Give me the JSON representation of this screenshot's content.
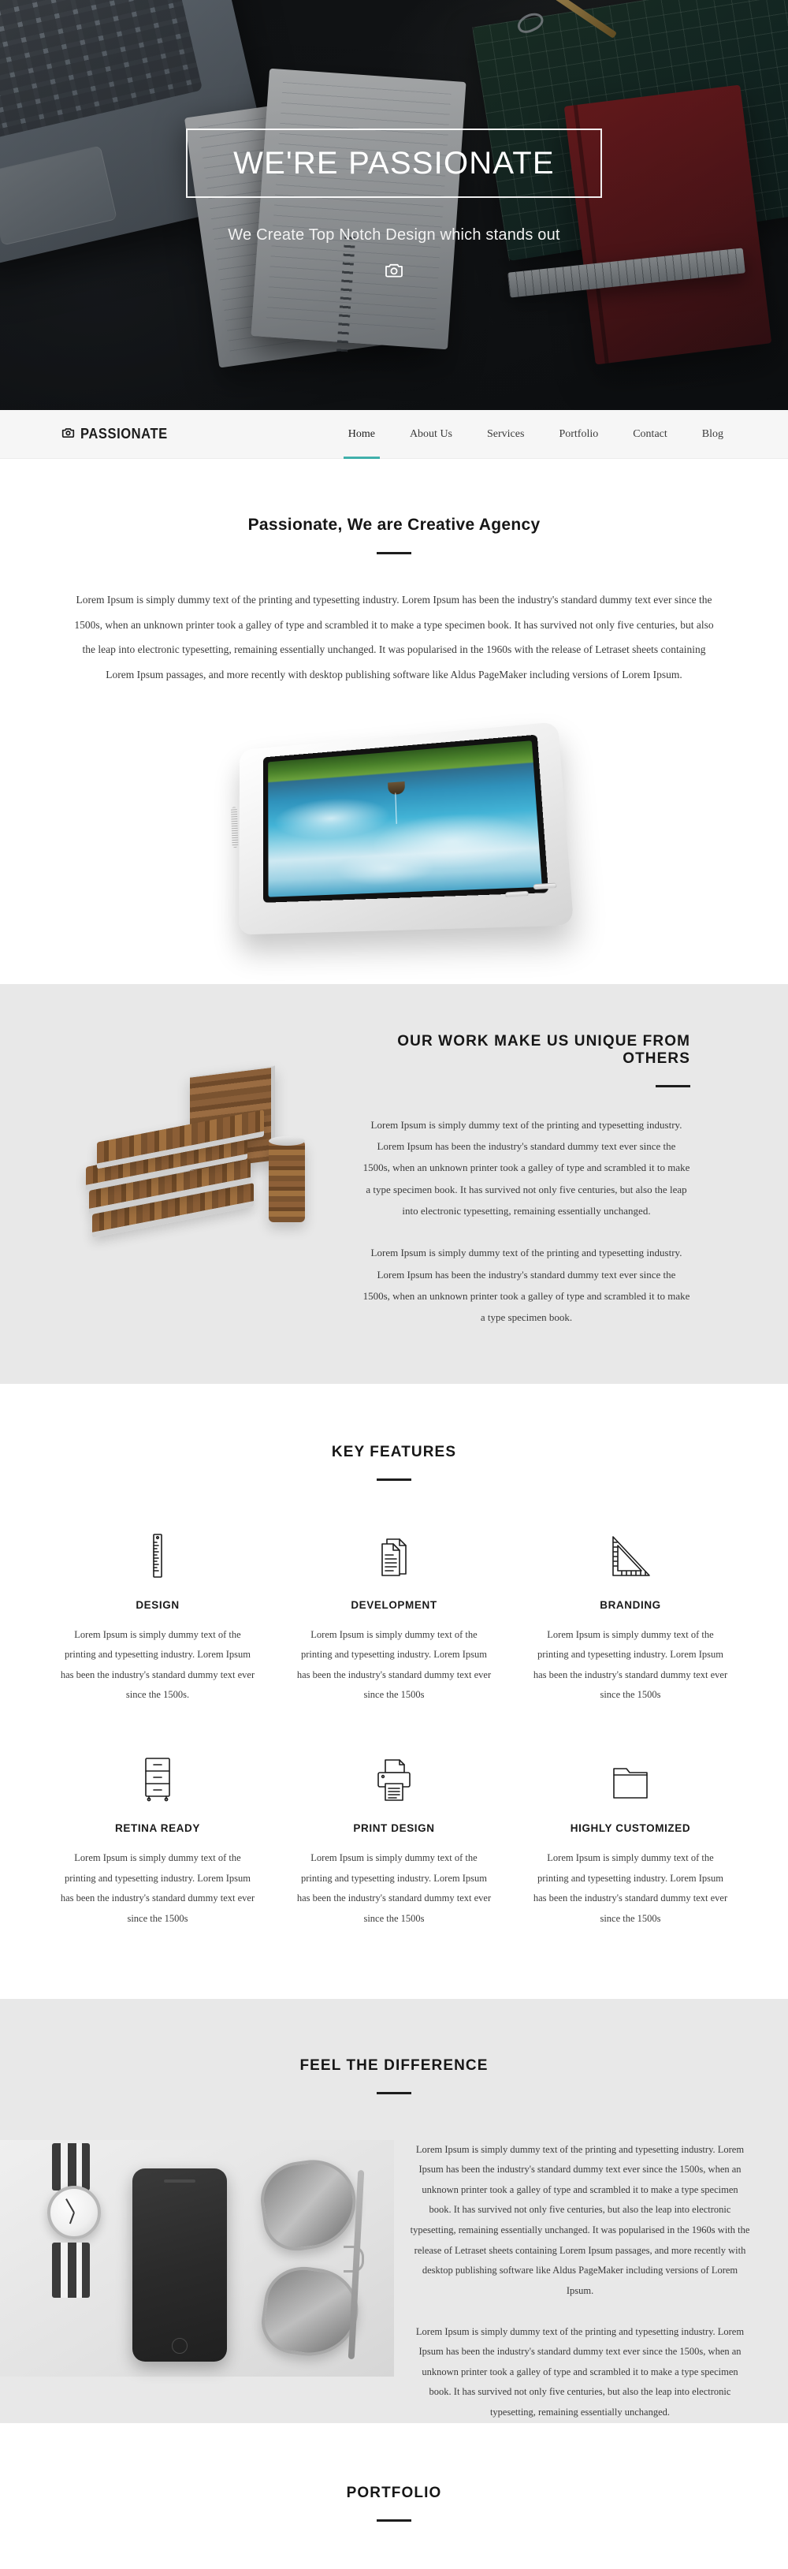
{
  "hero": {
    "title": "WE'RE PASSIONATE",
    "subtitle": "We Create Top Notch Design which stands out",
    "icon": "camera-icon"
  },
  "nav": {
    "brand": "PASSIONATE",
    "brand_icon": "camera-logo-icon",
    "items": [
      {
        "label": "Home",
        "active": true
      },
      {
        "label": "About Us",
        "active": false
      },
      {
        "label": "Services",
        "active": false
      },
      {
        "label": "Portfolio",
        "active": false
      },
      {
        "label": "Contact",
        "active": false
      },
      {
        "label": "Blog",
        "active": false
      }
    ],
    "active_color": "#41b0ab"
  },
  "intro": {
    "title": "Passionate, We are Creative Agency",
    "body": "Lorem Ipsum is simply dummy text of the printing and typesetting industry. Lorem Ipsum has been the industry's standard dummy text ever since the 1500s, when an unknown printer took a galley of type and scrambled it to make a type specimen book. It has survived not only five centuries, but also the leap into electronic typesetting, remaining essentially unchanged. It was popularised in the 1960s with the release of Letraset sheets containing Lorem Ipsum passages, and more recently with desktop publishing software like Aldus PageMaker including versions of Lorem Ipsum.",
    "image": "white-tablet-with-landscape-photo"
  },
  "unique": {
    "title": "OUR WORK MAKE US UNIQUE FROM OTHERS",
    "image": "stacked-wooden-books-and-can",
    "paragraph_1": "Lorem Ipsum is simply dummy text of the printing and typesetting industry. Lorem Ipsum has been the industry's standard dummy text ever since the 1500s, when an unknown printer took a galley of type and scrambled it to make a type specimen book. It has survived not only five centuries, but also the leap into electronic typesetting, remaining essentially unchanged.",
    "paragraph_2": "Lorem Ipsum is simply dummy text of the printing and typesetting industry. Lorem Ipsum has been the industry's standard dummy text ever since the 1500s, when an unknown printer took a galley of type and scrambled it to make a type specimen book."
  },
  "features": {
    "title": "KEY FEATURES",
    "items": [
      {
        "icon": "ruler-icon",
        "name": "DESIGN",
        "text": "Lorem Ipsum is simply dummy text of the printing and typesetting industry. Lorem Ipsum has been the industry's standard dummy text ever since the 1500s."
      },
      {
        "icon": "documents-icon",
        "name": "DEVELOPMENT",
        "text": "Lorem Ipsum is simply dummy text of the printing and typesetting industry. Lorem Ipsum has been the industry's standard dummy text ever since the 1500s"
      },
      {
        "icon": "set-square-icon",
        "name": "BRANDING",
        "text": "Lorem Ipsum is simply dummy text of the printing and typesetting industry. Lorem Ipsum has been the industry's standard dummy text ever since the 1500s"
      },
      {
        "icon": "filing-cabinet-icon",
        "name": "RETINA READY",
        "text": "Lorem Ipsum is simply dummy text of the printing and typesetting industry. Lorem Ipsum has been the industry's standard dummy text ever since the 1500s"
      },
      {
        "icon": "printer-icon",
        "name": "PRINT DESIGN",
        "text": "Lorem Ipsum is simply dummy text of the printing and typesetting industry. Lorem Ipsum has been the industry's standard dummy text ever since the 1500s"
      },
      {
        "icon": "folder-icon",
        "name": "HIGHLY CUSTOMIZED",
        "text": "Lorem Ipsum is simply dummy text of the printing and typesetting industry. Lorem Ipsum has been the industry's standard dummy text ever since the 1500s"
      }
    ]
  },
  "difference": {
    "title": "FEEL THE DIFFERENCE",
    "image": "black-and-white-flatlay-watch-phone-sunglasses",
    "paragraph_1": "Lorem Ipsum is simply dummy text of the printing and typesetting industry. Lorem Ipsum has been the industry's standard dummy text ever since the 1500s, when an unknown printer took a galley of type and scrambled it to make a type specimen book. It has survived not only five centuries, but also the leap into electronic typesetting, remaining essentially unchanged. It was popularised in the 1960s with the release of Letraset sheets containing Lorem Ipsum passages, and more recently with desktop publishing software like Aldus PageMaker including versions of Lorem Ipsum.",
    "paragraph_2": "Lorem Ipsum is simply dummy text of the printing and typesetting industry. Lorem Ipsum has been the industry's standard dummy text ever since the 1500s, when an unknown printer took a galley of type and scrambled it to make a type specimen book. It has survived not only five centuries, but also the leap into electronic typesetting, remaining essentially unchanged."
  },
  "portfolio": {
    "title": "PORTFOLIO"
  }
}
